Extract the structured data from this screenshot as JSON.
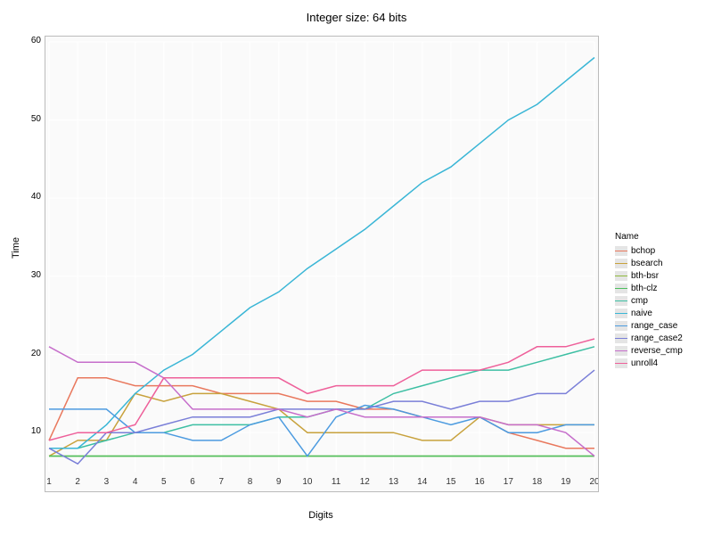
{
  "chart_data": {
    "type": "line",
    "title": "Integer size: 64 bits",
    "xlabel": "Digits",
    "ylabel": "Time",
    "xlim": [
      1,
      20
    ],
    "ylim": [
      5,
      60
    ],
    "x": [
      1,
      2,
      3,
      4,
      5,
      6,
      7,
      8,
      9,
      10,
      11,
      12,
      13,
      14,
      15,
      16,
      17,
      18,
      19,
      20
    ],
    "y_ticks": [
      10,
      20,
      30,
      40,
      50,
      60
    ],
    "legend_title": "Name",
    "series": [
      {
        "name": "bchop",
        "color": "#E9785D",
        "values": [
          9,
          17,
          17,
          16,
          16,
          16,
          15,
          15,
          15,
          14,
          14,
          13,
          13,
          12,
          12,
          12,
          10,
          9,
          8,
          8
        ]
      },
      {
        "name": "bsearch",
        "color": "#C8A23D",
        "values": [
          7,
          9,
          9,
          15,
          14,
          15,
          15,
          14,
          13,
          10,
          10,
          10,
          10,
          9,
          9,
          12,
          11,
          11,
          11,
          11
        ]
      },
      {
        "name": "bth-bsr",
        "color": "#8FB93E",
        "values": [
          7,
          7,
          7,
          7,
          7,
          7,
          7,
          7,
          7,
          7,
          7,
          7,
          7,
          7,
          7,
          7,
          7,
          7,
          7,
          7
        ]
      },
      {
        "name": "bth-clz",
        "color": "#4EBF5E",
        "values": [
          7,
          7,
          7,
          7,
          7,
          7,
          7,
          7,
          7,
          7,
          7,
          7,
          7,
          7,
          7,
          7,
          7,
          7,
          7,
          7
        ]
      },
      {
        "name": "cmp",
        "color": "#3DBFA3",
        "values": [
          8,
          8,
          9,
          10,
          10,
          11,
          11,
          11,
          12,
          12,
          13,
          13,
          15,
          16,
          17,
          18,
          18,
          19,
          20,
          21
        ]
      },
      {
        "name": "naive",
        "color": "#3AB6D6",
        "values": [
          8,
          8,
          11,
          15,
          18,
          20,
          23,
          26,
          28,
          31,
          33.5,
          36,
          39,
          42,
          44,
          47,
          50,
          52,
          55,
          58
        ]
      },
      {
        "name": "range_case",
        "color": "#4C9BE0",
        "values": [
          13,
          13,
          13,
          10,
          10,
          9,
          9,
          11,
          12,
          7,
          12,
          13.5,
          13,
          12,
          11,
          12,
          10,
          10,
          11,
          11
        ]
      },
      {
        "name": "range_case2",
        "color": "#7A7FD8",
        "values": [
          8,
          6,
          10,
          10,
          11,
          12,
          12,
          12,
          13,
          13,
          13,
          13,
          14,
          14,
          13,
          14,
          14,
          15,
          15,
          18
        ]
      },
      {
        "name": "reverse_cmp",
        "color": "#C66ECB",
        "values": [
          21,
          19,
          19,
          19,
          17,
          13,
          13,
          13,
          13,
          12,
          13,
          12,
          12,
          12,
          12,
          12,
          11,
          11,
          10,
          7
        ]
      },
      {
        "name": "unroll4",
        "color": "#EE609A",
        "values": [
          9,
          10,
          10,
          11,
          17,
          17,
          17,
          17,
          17,
          15,
          16,
          16,
          16,
          18,
          18,
          18,
          19,
          21,
          21,
          22
        ]
      }
    ]
  }
}
